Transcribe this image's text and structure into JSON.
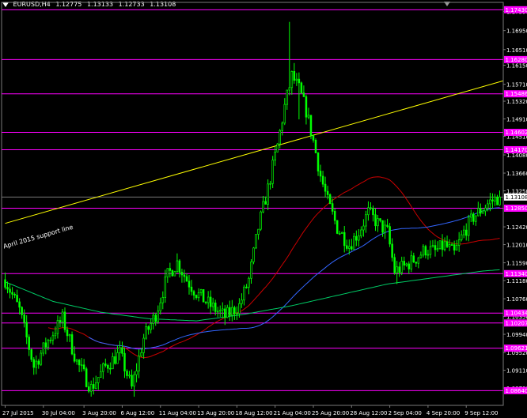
{
  "header": {
    "symbol": "EURUSD,H4",
    "open": "1.12775",
    "high": "1.13133",
    "low": "1.12733",
    "close": "1.13108"
  },
  "chart_data": {
    "type": "candlestick",
    "symbol": "EURUSD",
    "timeframe": "H4",
    "colors": {
      "background": "#000000",
      "bull": "#00ff00",
      "bear": "#00ff00",
      "grid": "#7a7a7a",
      "horizontal_lines": "#ff00ff",
      "trendline": "#ffff00",
      "ma_red": "#cc0000",
      "ma_blue": "#3366ff",
      "ma_green": "#00cc66",
      "current_price_line": "#7a7a7a"
    },
    "ylim": [
      1.083,
      1.176
    ],
    "y_ticks": [
      "1.17390",
      "1.16950",
      "1.16510",
      "1.16150",
      "1.15710",
      "1.15320",
      "1.14910",
      "1.14510",
      "1.14080",
      "1.13660",
      "1.13250",
      "1.12840",
      "1.12420",
      "1.12010",
      "1.11590",
      "1.11180",
      "1.10760",
      "1.10350",
      "1.09940",
      "1.09520",
      "1.09110",
      "1.08700"
    ],
    "x_ticks": [
      {
        "label": "27 Jul 2015",
        "i": 0
      },
      {
        "label": "30 Jul 04:00",
        "i": 16
      },
      {
        "label": "3 Aug 20:00",
        "i": 33
      },
      {
        "label": "6 Aug 12:00",
        "i": 49
      },
      {
        "label": "11 Aug 04:00",
        "i": 65
      },
      {
        "label": "13 Aug 20:00",
        "i": 81
      },
      {
        "label": "18 Aug 12:00",
        "i": 97
      },
      {
        "label": "21 Aug 04:00",
        "i": 113
      },
      {
        "label": "25 Aug 20:00",
        "i": 129
      },
      {
        "label": "28 Aug 12:00",
        "i": 145
      },
      {
        "label": "2 Sep 04:00",
        "i": 161
      },
      {
        "label": "4 Sep 20:00",
        "i": 177
      },
      {
        "label": "9 Sep 12:00",
        "i": 193
      }
    ],
    "bar_count": 208,
    "current_price": 1.13108,
    "current_price_label": "1.13108",
    "price_levels": [
      {
        "price": 1.1743,
        "label": "1.17430"
      },
      {
        "price": 1.1628,
        "label": "1.16280"
      },
      {
        "price": 1.1549,
        "label": "1.15486"
      },
      {
        "price": 1.146,
        "label": "1.14602"
      },
      {
        "price": 1.142,
        "label": "1.14170"
      },
      {
        "price": 1.1285,
        "label": "1.12850"
      },
      {
        "price": 1.1134,
        "label": "1.11340"
      },
      {
        "price": 1.1043,
        "label": "1.10434"
      },
      {
        "price": 1.102,
        "label": "1.10207"
      },
      {
        "price": 1.0962,
        "label": "1.09621"
      },
      {
        "price": 1.0864,
        "label": "1.08640"
      }
    ],
    "trendline": {
      "label": "April 2015 support line",
      "from": {
        "i": 0,
        "price": 1.125
      },
      "to": {
        "i": 216,
        "price": 1.1579
      }
    },
    "anchors": [
      [
        0,
        1.112
      ],
      [
        6,
        1.105
      ],
      [
        12,
        1.092
      ],
      [
        18,
        1.098
      ],
      [
        24,
        1.103
      ],
      [
        30,
        1.093
      ],
      [
        36,
        1.087
      ],
      [
        42,
        1.092
      ],
      [
        48,
        1.095
      ],
      [
        53,
        1.087
      ],
      [
        58,
        1.0985
      ],
      [
        63,
        1.104
      ],
      [
        68,
        1.113
      ],
      [
        72,
        1.116
      ],
      [
        76,
        1.112
      ],
      [
        80,
        1.109
      ],
      [
        86,
        1.106
      ],
      [
        92,
        1.1035
      ],
      [
        98,
        1.106
      ],
      [
        102,
        1.112
      ],
      [
        106,
        1.124
      ],
      [
        110,
        1.133
      ],
      [
        114,
        1.143
      ],
      [
        117,
        1.152
      ],
      [
        120,
        1.159
      ],
      [
        123,
        1.156
      ],
      [
        126,
        1.151
      ],
      [
        129,
        1.144
      ],
      [
        132,
        1.136
      ],
      [
        135,
        1.13
      ],
      [
        139,
        1.124
      ],
      [
        144,
        1.12
      ],
      [
        148,
        1.123
      ],
      [
        152,
        1.1275
      ],
      [
        156,
        1.125
      ],
      [
        160,
        1.123
      ],
      [
        163,
        1.114
      ],
      [
        167,
        1.115
      ],
      [
        172,
        1.117
      ],
      [
        176,
        1.119
      ],
      [
        180,
        1.1185
      ],
      [
        184,
        1.12
      ],
      [
        188,
        1.118
      ],
      [
        192,
        1.123
      ],
      [
        196,
        1.1265
      ],
      [
        200,
        1.1285
      ],
      [
        203,
        1.13
      ],
      [
        207,
        1.1311
      ]
    ],
    "spikes": [
      {
        "i": 119,
        "high": 1.1715
      },
      {
        "i": 121,
        "high": 1.162
      },
      {
        "i": 123,
        "low": 1.149
      },
      {
        "i": 54,
        "low": 1.085
      },
      {
        "i": 37,
        "low": 1.0855
      },
      {
        "i": 164,
        "low": 1.111
      }
    ],
    "moving_averages": [
      {
        "color_key": "ma_red",
        "period": 50
      },
      {
        "color_key": "ma_blue",
        "period": 100
      },
      {
        "color_key": "ma_green",
        "period": 200,
        "seed": [
          [
            0,
            1.1115
          ],
          [
            20,
            1.107
          ],
          [
            40,
            1.1045
          ],
          [
            60,
            1.103
          ],
          [
            80,
            1.1025
          ],
          [
            100,
            1.104
          ],
          [
            120,
            1.106
          ],
          [
            140,
            1.1085
          ],
          [
            160,
            1.111
          ],
          [
            180,
            1.1125
          ],
          [
            200,
            1.114
          ],
          [
            207,
            1.1143
          ]
        ]
      }
    ]
  }
}
